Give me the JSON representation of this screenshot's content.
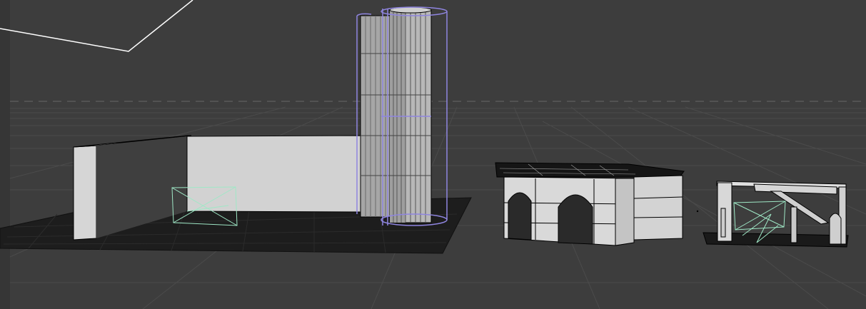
{
  "app": {
    "view": "3D viewport"
  },
  "colors": {
    "background": "#3d3d3d",
    "floor_line": "#4b4b4b",
    "dark_mesh": "#1c1c1c",
    "wall": "#d0d0d0",
    "wall_shadow": "#b8b8b8",
    "outline": "#000000",
    "selection": "#8f85e0",
    "light_gizmo": "#9fe8c6",
    "guide_line": "#ffffff"
  },
  "objects": [
    {
      "name": "ground-plane-grid",
      "kind": "plane"
    },
    {
      "name": "wall-left-tall",
      "kind": "wall"
    },
    {
      "name": "wall-center-long",
      "kind": "wall"
    },
    {
      "name": "cylinder-tower-selected",
      "kind": "cylinder",
      "selected": true
    },
    {
      "name": "arch-building",
      "kind": "building"
    },
    {
      "name": "small-structure-right",
      "kind": "structure"
    },
    {
      "name": "light-gizmo-left",
      "kind": "light"
    },
    {
      "name": "light-gizmo-right",
      "kind": "light"
    }
  ]
}
